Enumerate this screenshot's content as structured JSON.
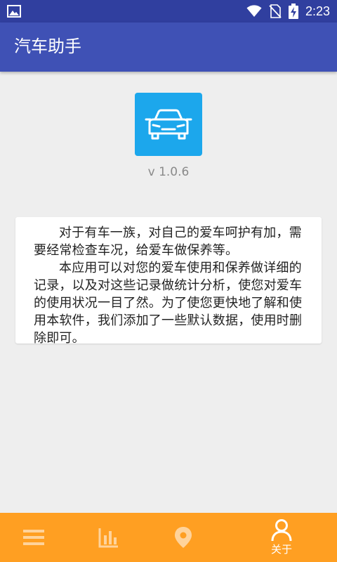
{
  "status_bar": {
    "time": "2:23"
  },
  "app_bar": {
    "title": "汽车助手"
  },
  "about": {
    "version": "v 1.0.6",
    "paragraphs": [
      "对于有车一族，对自己的爱车呵护有加，需要经常检查车况，给爱车做保养等。",
      "本应用可以对您的爱车使用和保养做详细的记录，以及对这些记录做统计分析，使您对爱车的使用状况一目了然。为了使您更快地了解和使用本软件，我们添加了一些默认数据，使用时删除即可。"
    ]
  },
  "bottom_nav": {
    "items": [
      {
        "icon": "menu-icon",
        "label": ""
      },
      {
        "icon": "chart-icon",
        "label": ""
      },
      {
        "icon": "location-pin-icon",
        "label": ""
      },
      {
        "icon": "person-icon",
        "label": "关于",
        "active": true
      }
    ]
  },
  "colors": {
    "status_bar": "#303f9f",
    "app_bar": "#3f51b5",
    "logo_bg": "#1ca7ec",
    "bottom_nav": "#ff9f22",
    "background": "#eeeeee"
  }
}
